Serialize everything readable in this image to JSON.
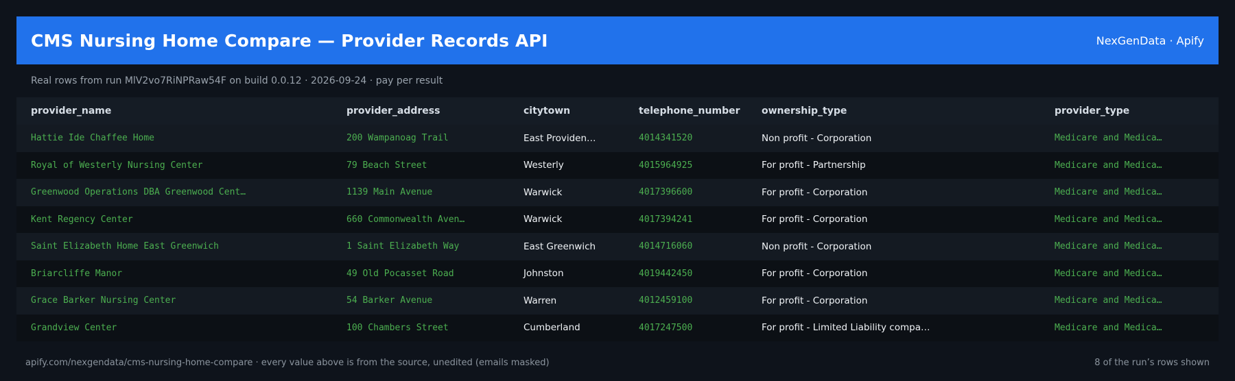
{
  "header": {
    "title": "CMS Nursing Home Compare — Provider Records API",
    "brand": "NexGenData · Apify"
  },
  "subtitle": "Real rows from run MlV2vo7RiNPRaw54F on build 0.0.12 · 2026-09-24 · pay per result",
  "table": {
    "columns": [
      "provider_name",
      "provider_address",
      "citytown",
      "telephone_number",
      "ownership_type",
      "provider_type"
    ],
    "rows": [
      [
        "Hattie Ide Chaffee Home",
        "200 Wampanoag Trail",
        "East Providen…",
        "4014341520",
        "Non profit - Corporation",
        "Medicare and Medica…"
      ],
      [
        "Royal of Westerly Nursing Center",
        "79 Beach Street",
        "Westerly",
        "4015964925",
        "For profit - Partnership",
        "Medicare and Medica…"
      ],
      [
        "Greenwood Operations DBA Greenwood Cent…",
        "1139 Main Avenue",
        "Warwick",
        "4017396600",
        "For profit - Corporation",
        "Medicare and Medica…"
      ],
      [
        "Kent Regency Center",
        "660 Commonwealth Aven…",
        "Warwick",
        "4017394241",
        "For profit - Corporation",
        "Medicare and Medica…"
      ],
      [
        "Saint Elizabeth Home East Greenwich",
        "1 Saint Elizabeth Way",
        "East Greenwich",
        "4014716060",
        "Non profit - Corporation",
        "Medicare and Medica…"
      ],
      [
        "Briarcliffe Manor",
        "49 Old Pocasset Road",
        "Johnston",
        "4019442450",
        "For profit - Corporation",
        "Medicare and Medica…"
      ],
      [
        "Grace Barker Nursing Center",
        "54 Barker Avenue",
        "Warren",
        "4012459100",
        "For profit - Corporation",
        "Medicare and Medica…"
      ],
      [
        "Grandview Center",
        "100 Chambers Street",
        "Cumberland",
        "4017247500",
        "For profit - Limited Liability compa…",
        "Medicare and Medica…"
      ]
    ]
  },
  "footer": {
    "left": "apify.com/nexgendata/cms-nursing-home-compare  ·  every value above is from the source, unedited (emails masked)",
    "right": "8 of the run’s rows shown"
  },
  "colors": {
    "background": "#0e131b",
    "header": "#2172eb",
    "accent_green": "#4caf50"
  }
}
